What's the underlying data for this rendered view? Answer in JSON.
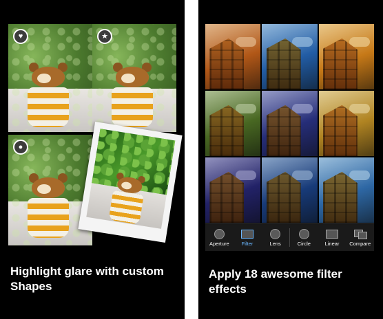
{
  "left_panel": {
    "caption": "Highlight glare with custom Shapes",
    "tiles": [
      {
        "shape_icon": "heart-icon",
        "glyph": "♥"
      },
      {
        "shape_icon": "star-icon",
        "glyph": "★"
      },
      {
        "shape_icon": "circle-icon",
        "glyph": "●"
      }
    ]
  },
  "right_panel": {
    "caption": "Apply 18 awesome filter effects",
    "filter_tints": [
      "#c97a2a",
      "#3a7fbf",
      "#d89a2a",
      "#6a8a3a",
      "#404a9a",
      "#c8a43a",
      "#3a3a8a",
      "#2a5a9a",
      "#4a8abf"
    ],
    "toolbar": [
      {
        "label": "Aperture",
        "icon": "aperture-icon",
        "active": false
      },
      {
        "label": "Filter",
        "icon": "filter-icon",
        "active": true
      },
      {
        "label": "Lens",
        "icon": "lens-icon",
        "active": false
      },
      {
        "label": "Circle",
        "icon": "circle-icon",
        "active": false
      },
      {
        "label": "Linear",
        "icon": "linear-icon",
        "active": false
      },
      {
        "label": "Compare",
        "icon": "compare-icon",
        "active": false
      }
    ]
  },
  "colors": {
    "background": "#000000",
    "active_tool": "#6ab7ff"
  }
}
